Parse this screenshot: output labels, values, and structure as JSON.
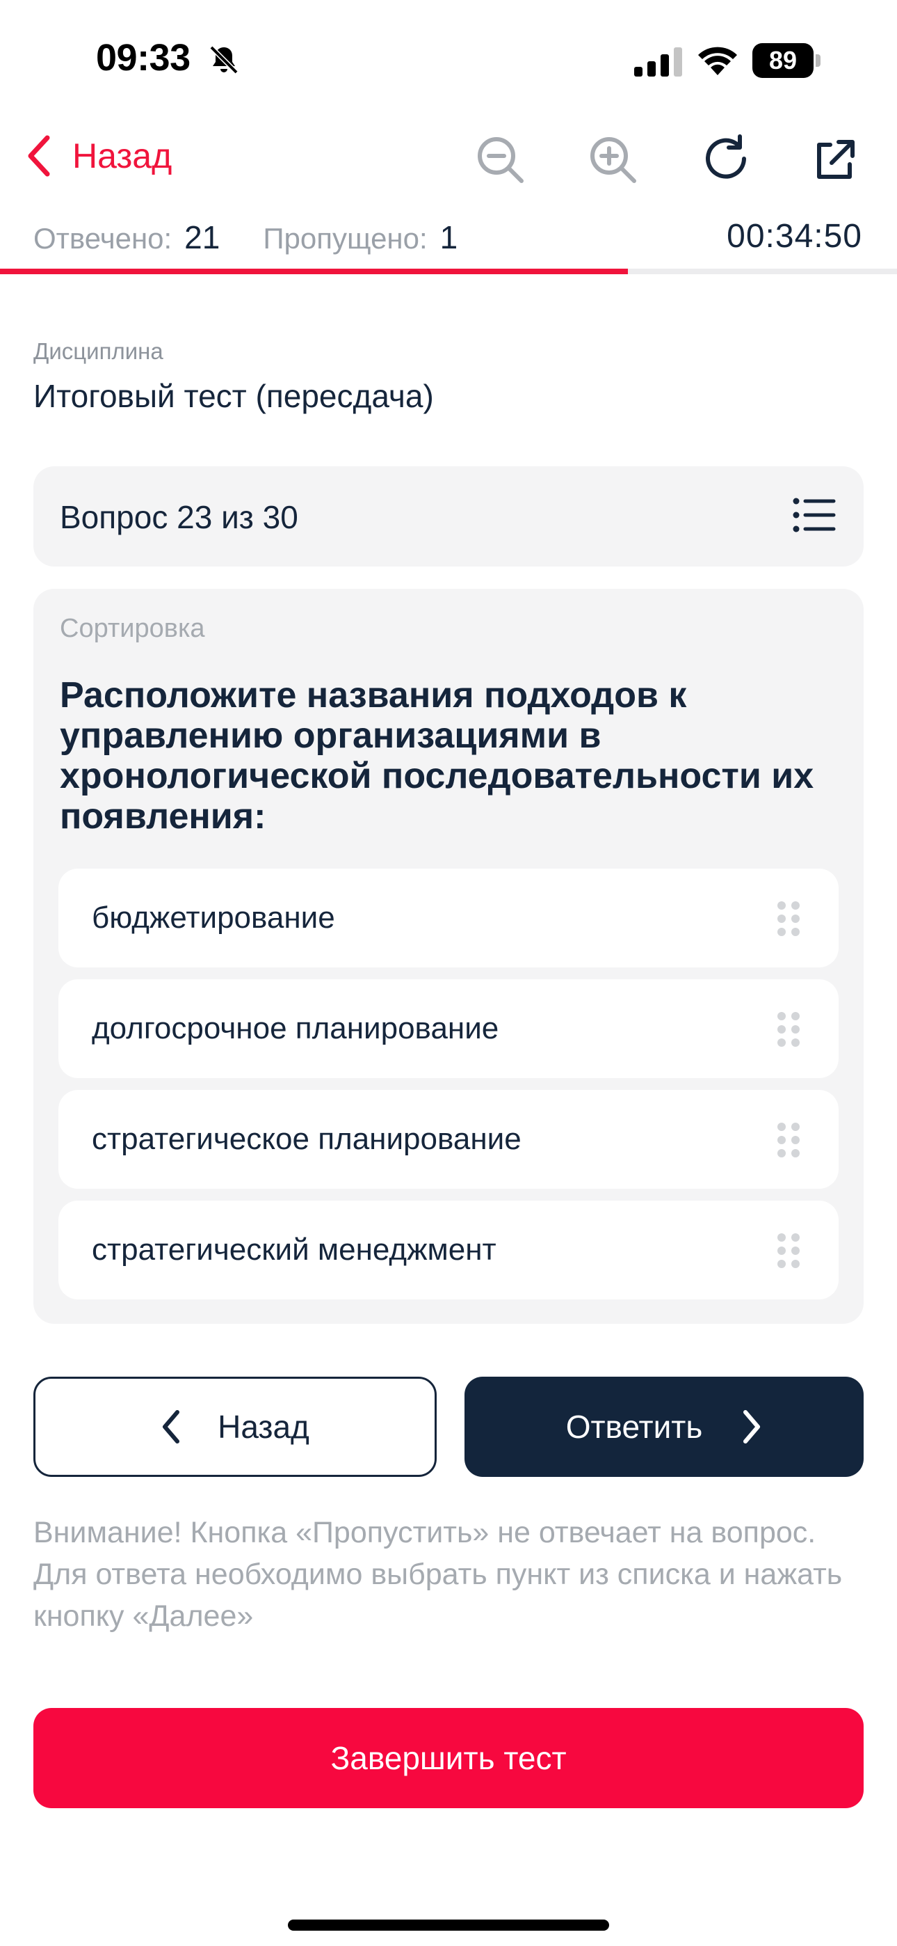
{
  "status_bar": {
    "time": "09:33",
    "battery": "89"
  },
  "nav": {
    "back_label": "Назад"
  },
  "counters": {
    "answered_label": "Отвечено:",
    "answered_value": "21",
    "skipped_label": "Пропущено:",
    "skipped_value": "1",
    "timer": "00:34:50"
  },
  "progress": {
    "fraction": 0.7
  },
  "discipline": {
    "label": "Дисциплина",
    "value": "Итоговый тест (пересдача)"
  },
  "question": {
    "title": "Вопрос 23 из 30",
    "type": "Сортировка",
    "text": "Расположите названия подходов к управлению организациями в хронологической последовательности их появления:",
    "options": [
      "бюджетирование",
      "долгосрочное планирование",
      "стратегическое планирование",
      "стратегический менеджмент"
    ]
  },
  "actions": {
    "back_label": "Назад",
    "answer_label": "Ответить",
    "finish_label": "Завершить тест"
  },
  "notice": "Внимание! Кнопка «Пропустить» не отвечает на вопрос. Для ответа необходимо выбрать пункт из списка и нажать кнопку «Далее»",
  "colors": {
    "accent": "#f0143c",
    "dark": "#13253c",
    "muted": "#a5aab0",
    "card": "#f4f4f5"
  }
}
